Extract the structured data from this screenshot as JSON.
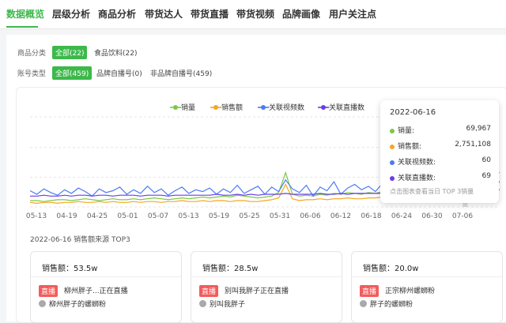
{
  "nav": {
    "tabs": [
      {
        "label": "数据概览",
        "active": true
      },
      {
        "label": "层级分析",
        "active": false
      },
      {
        "label": "商品分析",
        "active": false
      },
      {
        "label": "带货达人",
        "active": false
      },
      {
        "label": "带货直播",
        "active": false
      },
      {
        "label": "带货视频",
        "active": false
      },
      {
        "label": "品牌画像",
        "active": false
      },
      {
        "label": "用户关注点",
        "active": false
      }
    ]
  },
  "filters": {
    "category": {
      "label": "商品分类",
      "options": [
        "全部(22)",
        "食品饮料(22)"
      ]
    },
    "account": {
      "label": "账号类型",
      "options": [
        "全部(459)",
        "品牌自播号(0)",
        "非品牌自播号(459)"
      ]
    }
  },
  "legend": [
    {
      "label": "销量",
      "color": "#7ac943"
    },
    {
      "label": "销售额",
      "color": "#f5a623"
    },
    {
      "label": "关联视频数",
      "color": "#4a7bf7"
    },
    {
      "label": "关联直播数",
      "color": "#6a3de8"
    }
  ],
  "chart_data": {
    "type": "line",
    "x_ticks": [
      "05-13",
      "04-19",
      "04-25",
      "05-01",
      "05-07",
      "05-13",
      "05-19",
      "05-25",
      "05-31",
      "06-06",
      "06-12",
      "06-18",
      "06-24",
      "06-30",
      "07-06"
    ],
    "highlight_x": "2022-06-16",
    "series": [
      {
        "name": "销量",
        "color": "#7ac943",
        "values": [
          0.07,
          0.07,
          0.06,
          0.07,
          0.08,
          0.08,
          0.07,
          0.08,
          0.09,
          0.08,
          0.07,
          0.08,
          0.09,
          0.08,
          0.08,
          0.09,
          0.08,
          0.09,
          0.1,
          0.09,
          0.08,
          0.09,
          0.1,
          0.09,
          0.1,
          0.11,
          0.1,
          0.11,
          0.12,
          0.11,
          0.13,
          0.12,
          0.11,
          0.1,
          0.11,
          0.12,
          0.16,
          0.38,
          0.14,
          0.12,
          0.13,
          0.12,
          0.14,
          0.13,
          0.15,
          0.14,
          0.16,
          0.15,
          0.14,
          0.16,
          0.15,
          0.17,
          0.18,
          0.2,
          0.28,
          0.22,
          0.3,
          0.4,
          0.55,
          0.38,
          0.42,
          0.46,
          0.6,
          0.91,
          0.62,
          0.5,
          0.44,
          0.4,
          0.38
        ]
      },
      {
        "name": "销售额",
        "color": "#f5a623",
        "values": [
          0.05,
          0.04,
          0.05,
          0.05,
          0.04,
          0.05,
          0.05,
          0.06,
          0.05,
          0.05,
          0.06,
          0.05,
          0.06,
          0.05,
          0.05,
          0.06,
          0.05,
          0.06,
          0.06,
          0.05,
          0.06,
          0.06,
          0.07,
          0.06,
          0.06,
          0.07,
          0.06,
          0.07,
          0.07,
          0.06,
          0.07,
          0.07,
          0.06,
          0.06,
          0.07,
          0.08,
          0.1,
          0.25,
          0.09,
          0.07,
          0.08,
          0.08,
          0.09,
          0.08,
          0.09,
          0.09,
          0.1,
          0.09,
          0.09,
          0.1,
          0.1,
          0.11,
          0.11,
          0.12,
          0.16,
          0.13,
          0.17,
          0.22,
          0.3,
          0.22,
          0.24,
          0.26,
          0.34,
          0.57,
          0.4,
          0.33,
          0.3,
          0.28,
          0.27
        ]
      },
      {
        "name": "关联视频数",
        "color": "#4a7bf7",
        "values": [
          0.18,
          0.14,
          0.2,
          0.16,
          0.13,
          0.19,
          0.15,
          0.21,
          0.17,
          0.12,
          0.2,
          0.16,
          0.18,
          0.22,
          0.14,
          0.19,
          0.15,
          0.23,
          0.16,
          0.2,
          0.13,
          0.18,
          0.22,
          0.15,
          0.19,
          0.17,
          0.21,
          0.14,
          0.2,
          0.16,
          0.24,
          0.15,
          0.19,
          0.23,
          0.14,
          0.22,
          0.17,
          0.3,
          0.2,
          0.16,
          0.24,
          0.12,
          0.22,
          0.18,
          0.28,
          0.14,
          0.21,
          0.25,
          0.19,
          0.23,
          0.17,
          0.26,
          0.2,
          0.24,
          0.22,
          0.27,
          0.25,
          0.21,
          0.29,
          0.23,
          0.26,
          0.24,
          0.27,
          0.25,
          0.26,
          0.28,
          0.27,
          0.29,
          0.28
        ]
      },
      {
        "name": "关联直播数",
        "color": "#6a3de8",
        "values": [
          0.12,
          0.12,
          0.13,
          0.12,
          0.12,
          0.13,
          0.12,
          0.13,
          0.13,
          0.12,
          0.13,
          0.13,
          0.12,
          0.13,
          0.13,
          0.13,
          0.12,
          0.13,
          0.13,
          0.13,
          0.12,
          0.13,
          0.13,
          0.13,
          0.13,
          0.13,
          0.13,
          0.14,
          0.13,
          0.13,
          0.14,
          0.13,
          0.14,
          0.13,
          0.14,
          0.14,
          0.14,
          0.15,
          0.14,
          0.14,
          0.14,
          0.14,
          0.15,
          0.14,
          0.14,
          0.15,
          0.14,
          0.15,
          0.15,
          0.15,
          0.15,
          0.15,
          0.16,
          0.15,
          0.16,
          0.16,
          0.16,
          0.16,
          0.17,
          0.17,
          0.17,
          0.17,
          0.17,
          0.18,
          0.18,
          0.18,
          0.18,
          0.19,
          0.19
        ]
      }
    ]
  },
  "tooltip": {
    "date": "2022-06-16",
    "rows": [
      {
        "label": "销量:",
        "value": "69,967",
        "color": "#7ac943"
      },
      {
        "label": "销售额:",
        "value": "2,751,108",
        "color": "#f5a623"
      },
      {
        "label": "关联视频数:",
        "value": "60",
        "color": "#4a7bf7"
      },
      {
        "label": "关联直播数:",
        "value": "69",
        "color": "#6a3de8"
      }
    ],
    "hint": "点击图表查看当日 TOP 3销量"
  },
  "top3": {
    "title": "2022-06-16 销售额来源 TOP3",
    "cards": [
      {
        "amount": "销售额：53.5w",
        "badge": "直播",
        "title": "柳州胖子...正在直播",
        "author": "柳州胖子的螺蛳粉"
      },
      {
        "amount": "销售额：28.5w",
        "badge": "直播",
        "title": "别叫我胖子正在直播",
        "author": "别叫我胖子"
      },
      {
        "amount": "销售额：20.0w",
        "badge": "直播",
        "title": "正宗柳州螺蛳粉",
        "author": "胖子的螺蛳粉"
      }
    ]
  }
}
